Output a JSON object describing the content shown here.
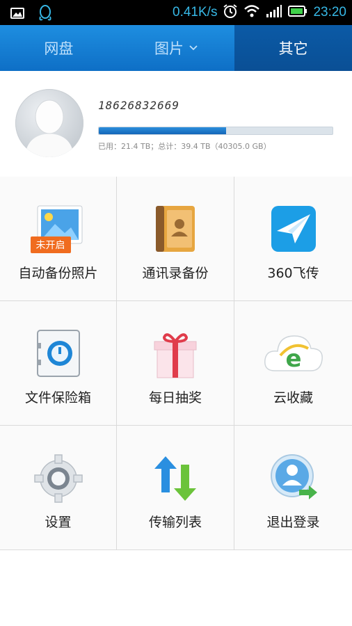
{
  "status_bar": {
    "speed": "0.41K/s",
    "time": "23:20",
    "icons": [
      "image-icon",
      "qq-icon",
      "alarm-icon",
      "wifi-icon",
      "signal-icon",
      "battery-icon"
    ]
  },
  "tabs": [
    {
      "label": "网盘",
      "active": false
    },
    {
      "label": "图片",
      "active": false,
      "dropdown": true
    },
    {
      "label": "其它",
      "active": true
    }
  ],
  "profile": {
    "phone": "18626832669",
    "usage_fraction": 0.546,
    "usage_text": "已用：21.4 TB；总计：39.4 TB（40305.0 GB）"
  },
  "features": [
    {
      "label": "自动备份照片",
      "icon": "photo-backup-icon",
      "badge": "未开启"
    },
    {
      "label": "通讯录备份",
      "icon": "contacts-book-icon"
    },
    {
      "label": "360飞传",
      "icon": "paper-plane-icon"
    },
    {
      "label": "文件保险箱",
      "icon": "safe-icon"
    },
    {
      "label": "每日抽奖",
      "icon": "gift-icon"
    },
    {
      "label": "云收藏",
      "icon": "cloud-ie-icon"
    },
    {
      "label": "设置",
      "icon": "gear-icon"
    },
    {
      "label": "传输列表",
      "icon": "transfer-arrows-icon"
    },
    {
      "label": "退出登录",
      "icon": "logout-user-icon"
    }
  ],
  "colors": {
    "accent": "#1479cf",
    "badge": "#f06c1f",
    "status_text": "#37b8e6"
  }
}
